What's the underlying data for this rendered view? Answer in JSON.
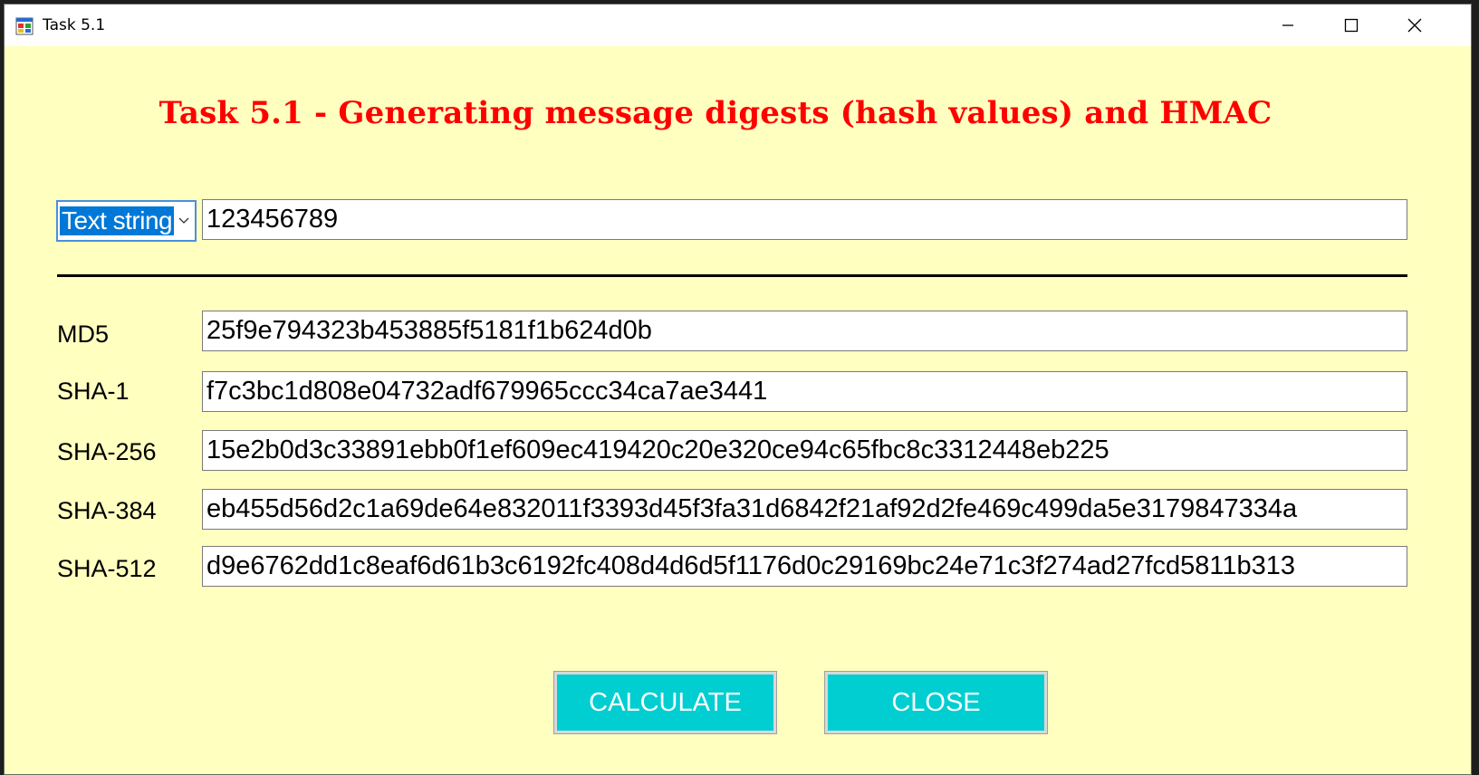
{
  "window": {
    "title": "Task 5.1",
    "icon": "windows-forms-app-icon",
    "controls": [
      "minimize-icon",
      "maximize-icon",
      "close-icon"
    ]
  },
  "heading": "Task 5.1 - Generating message digests (hash values) and HMAC",
  "input": {
    "type_selected": "Text string",
    "value": "123456789"
  },
  "hashes": [
    {
      "label": "MD5",
      "value": "25f9e794323b453885f5181f1b624d0b"
    },
    {
      "label": "SHA-1",
      "value": "f7c3bc1d808e04732adf679965ccc34ca7ae3441"
    },
    {
      "label": "SHA-256",
      "value": "15e2b0d3c33891ebb0f1ef609ec419420c20e320ce94c65fbc8c3312448eb225"
    },
    {
      "label": "SHA-384",
      "value": "eb455d56d2c1a69de64e832011f3393d45f3fa31d6842f21af92d2fe469c499da5e3179847334a"
    },
    {
      "label": "SHA-512",
      "value": "d9e6762dd1c8eaf6d61b3c6192fc408d4d6d5f1176d0c29169bc24e71c3f274ad27fcd5811b313"
    }
  ],
  "buttons": {
    "calculate": "CALCULATE",
    "close": "CLOSE"
  },
  "colors": {
    "form_background": "#ffffc0",
    "heading": "#ff0000",
    "button_background": "#00ced1",
    "selection": "#0078d7"
  }
}
